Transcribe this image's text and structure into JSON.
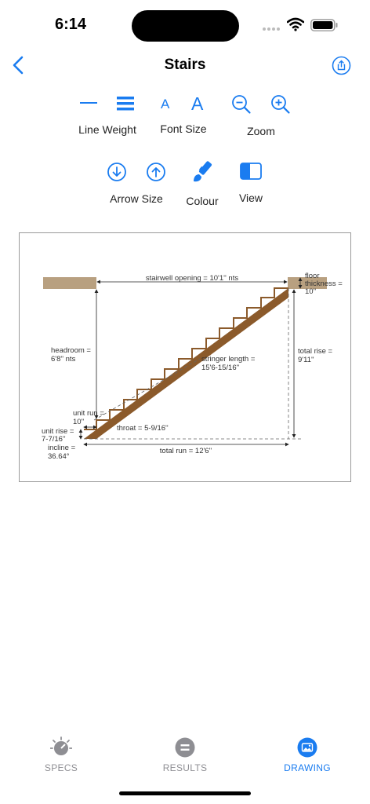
{
  "status_bar": {
    "time": "6:14"
  },
  "nav": {
    "title": "Stairs"
  },
  "toolbar": {
    "line_weight_label": "Line Weight",
    "font_size_label": "Font Size",
    "zoom_label": "Zoom",
    "arrow_size_label": "Arrow Size",
    "colour_label": "Colour",
    "view_label": "View",
    "font_small_glyph": "A",
    "font_large_glyph": "A"
  },
  "drawing": {
    "stairwell_opening": "stairwell opening = 10'1'' nts",
    "floor_thickness_1": "floor",
    "floor_thickness_2": "thickness =",
    "floor_thickness_3": "10''",
    "headroom_1": "headroom =",
    "headroom_2": "6'8'' nts",
    "total_rise_1": "total rise =",
    "total_rise_2": "9'11''",
    "stringer_1": "stringer length =",
    "stringer_2": "15'6-15/16''",
    "unit_run_1": "unit run =",
    "unit_run_2": "10''",
    "throat": "throat = 5-9/16''",
    "unit_rise_1": "unit rise =",
    "unit_rise_2": "7-7/16''",
    "incline_1": "incline =",
    "incline_2": "36.64°",
    "total_run": "total run = 12'6''"
  },
  "tabs": [
    {
      "label": "SPECS",
      "active": false
    },
    {
      "label": "RESULTS",
      "active": false
    },
    {
      "label": "DRAWING",
      "active": true
    }
  ],
  "colors": {
    "accent": "#1a7cf0",
    "wood": "#8b5a2b",
    "floor": "#b8a080"
  }
}
